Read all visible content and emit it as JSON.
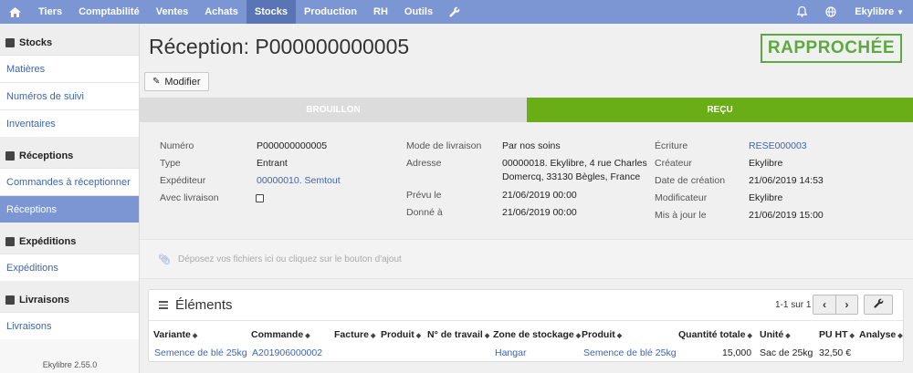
{
  "nav": {
    "items": [
      "Tiers",
      "Comptabilité",
      "Ventes",
      "Achats",
      "Stocks",
      "Production",
      "RH",
      "Outils"
    ],
    "active": "Stocks",
    "user": "Ekylibre"
  },
  "sidebar": {
    "sections": [
      {
        "title": "Stocks",
        "items": [
          "Matières",
          "Numéros de suivi",
          "Inventaires"
        ]
      },
      {
        "title": "Réceptions",
        "items": [
          "Commandes à réceptionner",
          "Réceptions"
        ]
      },
      {
        "title": "Expéditions",
        "items": [
          "Expéditions"
        ]
      },
      {
        "title": "Livraisons",
        "items": [
          "Livraisons"
        ]
      }
    ],
    "active_item": "Réceptions",
    "version": "Ekylibre 2.55.0"
  },
  "page": {
    "title": "Réception: P000000000005",
    "status": "RAPPROCHÉE",
    "modify_label": "Modifier"
  },
  "steps": [
    "BROUILLON",
    "REÇU"
  ],
  "details": {
    "col1": [
      {
        "label": "Numéro",
        "value": "P000000000005"
      },
      {
        "label": "Type",
        "value": "Entrant"
      },
      {
        "label": "Expéditeur",
        "value": "00000010. Semtout"
      },
      {
        "label": "Avec livraison",
        "value": ""
      }
    ],
    "col2": [
      {
        "label": "Mode de livraison",
        "value": "Par nos soins"
      },
      {
        "label": "Adresse",
        "value_line1": "00000018. Ekylibre, 4 rue Charles",
        "value_line2": "Domercq, 33130 Bègles, France"
      },
      {
        "label": "Prévu le",
        "value": "21/06/2019 00:00"
      },
      {
        "label": "Donné à",
        "value": "21/06/2019 00:00"
      }
    ],
    "col3": [
      {
        "label": "Écriture",
        "value": "RESE000003"
      },
      {
        "label": "Créateur",
        "value": "Ekylibre"
      },
      {
        "label": "Date de création",
        "value": "21/06/2019 14:53"
      },
      {
        "label": "Modificateur",
        "value": "Ekylibre"
      },
      {
        "label": "Mis à jour le",
        "value": "21/06/2019 15:00"
      }
    ]
  },
  "dropzone": "Déposez vos fichiers ici ou cliquez sur le bouton d'ajout",
  "elements": {
    "title": "Éléments",
    "pager": "1-1 sur 1",
    "columns": [
      "Variante",
      "Commande",
      "Facture",
      "Produit",
      "N° de travail",
      "Zone de stockage",
      "Produit",
      "Quantité totale",
      "Unité",
      "PU HT",
      "Analyse"
    ],
    "rows": [
      [
        "Semence de blé 25kg",
        "A201906000002",
        "",
        "",
        "",
        "Hangar",
        "Semence de blé 25kg",
        "15,000",
        "Sac de 25kg",
        "32,50 €",
        ""
      ]
    ]
  }
}
